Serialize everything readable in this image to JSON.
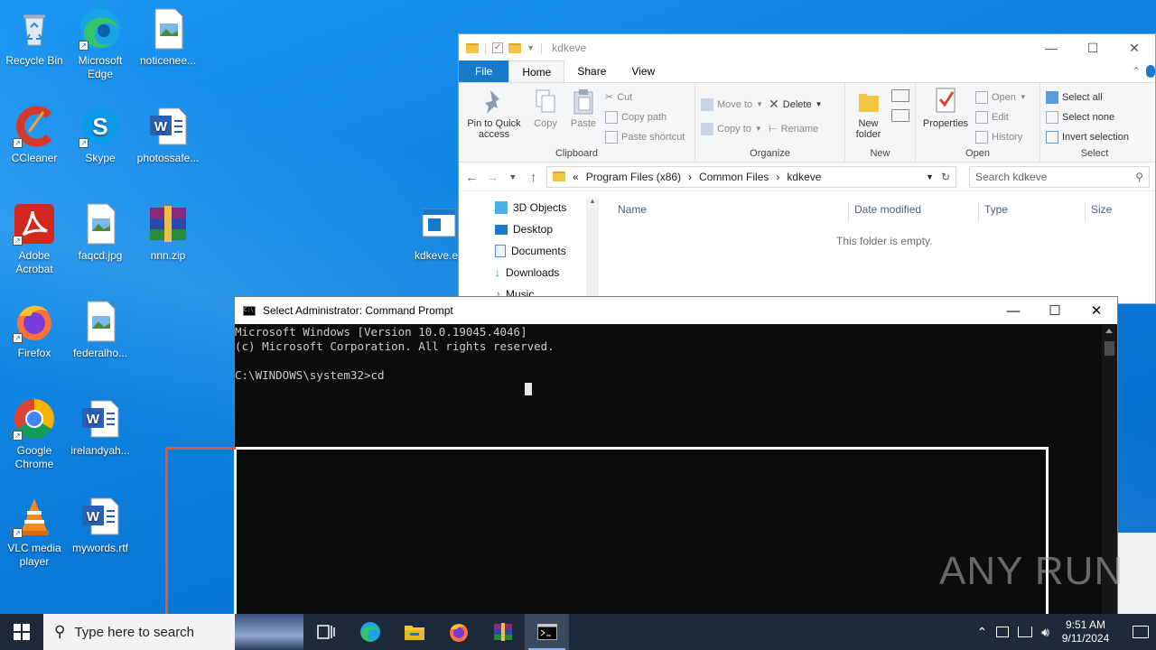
{
  "desktop": {
    "icons": [
      {
        "label": "Recycle Bin"
      },
      {
        "label": "Microsoft Edge"
      },
      {
        "label": "noticenee..."
      },
      {
        "label": "CCleaner"
      },
      {
        "label": "Skype"
      },
      {
        "label": "photossafe..."
      },
      {
        "label": "Adobe Acrobat"
      },
      {
        "label": "faqcd.jpg"
      },
      {
        "label": "nnn.zip"
      },
      {
        "label": "kdkeve.ex"
      },
      {
        "label": "Firefox"
      },
      {
        "label": "federalho..."
      },
      {
        "label": "Google Chrome"
      },
      {
        "label": "irelandyah..."
      },
      {
        "label": "VLC media player"
      },
      {
        "label": "mywords.rtf"
      }
    ]
  },
  "explorer": {
    "title": "kdkeve",
    "tabs": [
      "File",
      "Home",
      "Share",
      "View"
    ],
    "clipboard": {
      "pin": "Pin to Quick access",
      "copy": "Copy",
      "paste": "Paste",
      "cut": "Cut",
      "copy_path": "Copy path",
      "paste_shortcut": "Paste shortcut",
      "label": "Clipboard"
    },
    "organize": {
      "move_to": "Move to",
      "copy_to": "Copy to",
      "delete": "Delete",
      "rename": "Rename",
      "label": "Organize"
    },
    "new": {
      "new_folder": "New folder",
      "label": "New"
    },
    "open": {
      "properties": "Properties",
      "open": "Open",
      "edit": "Edit",
      "history": "History",
      "label": "Open"
    },
    "select": {
      "select_all": "Select all",
      "select_none": "Select none",
      "invert": "Invert selection",
      "label": "Select"
    },
    "address": {
      "overflow": "«",
      "crumbs": [
        "Program Files (x86)",
        "Common Files",
        "kdkeve"
      ]
    },
    "search_placeholder": "Search kdkeve",
    "nav": [
      "3D Objects",
      "Desktop",
      "Documents",
      "Downloads",
      "Music"
    ],
    "columns": [
      "Name",
      "Date modified",
      "Type",
      "Size"
    ],
    "empty_text": "This folder is empty."
  },
  "cmd": {
    "title": "Select Administrator: Command Prompt",
    "lines": [
      "Microsoft Windows [Version 10.0.19045.4046]",
      "(c) Microsoft Corporation. All rights reserved.",
      "",
      "C:\\WINDOWS\\system32>cd"
    ]
  },
  "watermark": "ANY RUN",
  "taskbar": {
    "search_placeholder": "Type here to search",
    "time": "9:51 AM",
    "date": "9/11/2024"
  },
  "colors": {
    "accent": "#1979ca",
    "desktop": "#0a7ad8",
    "taskbar": "#1c2a3a"
  }
}
